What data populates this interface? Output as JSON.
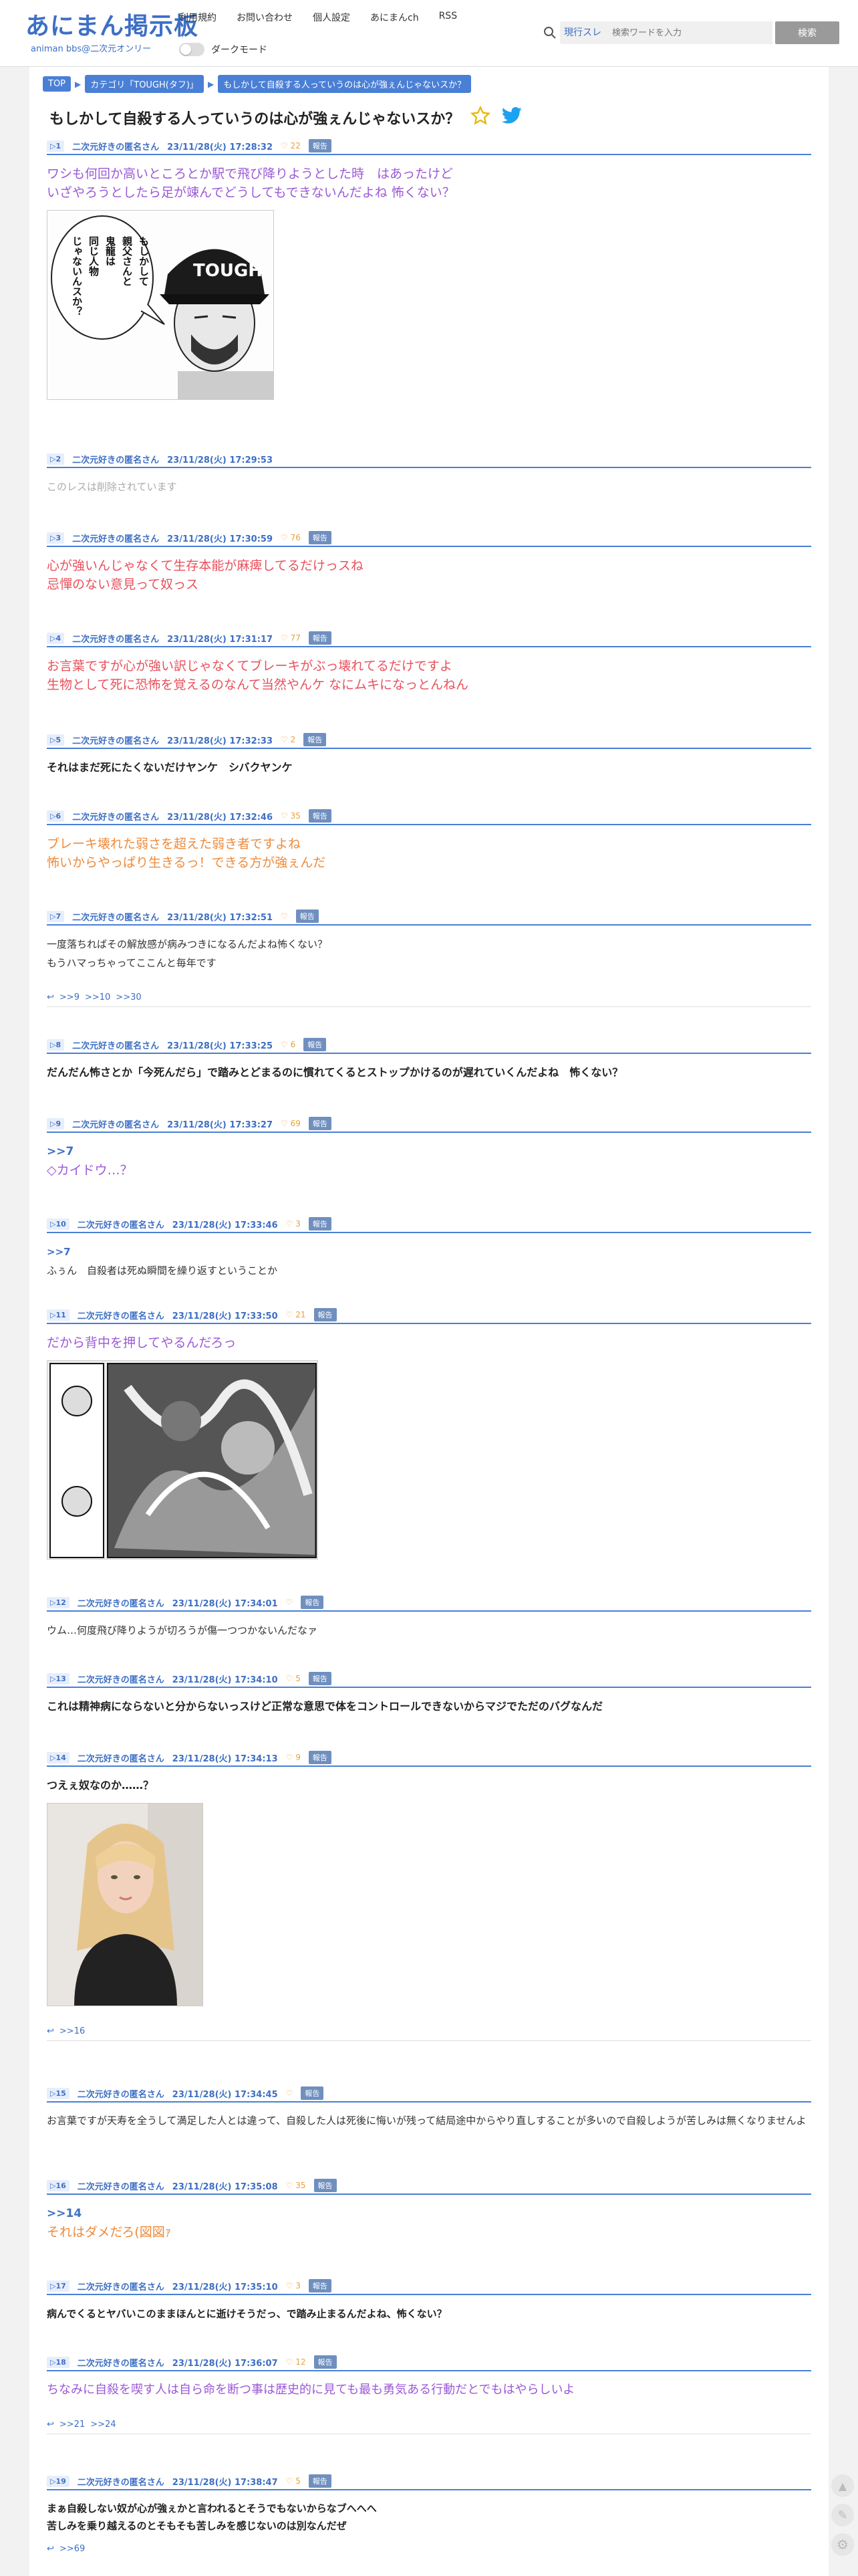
{
  "header": {
    "logo_main": "あにまん掲示板",
    "logo_sub": "animan bbs@二次元オンリー",
    "nav": [
      "利用規約",
      "お問い合わせ",
      "個人設定",
      "あにまんch",
      "RSS"
    ],
    "dark_mode_label": "ダークモード",
    "search_type": "現行スレ",
    "search_placeholder": "検索ワードを入力",
    "search_button": "検索"
  },
  "breadcrumb": [
    "TOP",
    "カテゴリ「TOUGH(タフ)」",
    "もしかして自殺する人っていうのは心が強ぇんじゃないスか？"
  ],
  "thread": {
    "title": "もしかして自殺する人っていうのは心が強ぇんじゃないスか？"
  },
  "common": {
    "name": "二次元好きの匿名さん",
    "report": "報告"
  },
  "posts": [
    {
      "num": "1",
      "date": "23/11/28(火) 17:28:32",
      "likes": "22",
      "lines": [
        "ワシも何回か高いところとか駅で飛び降りようとした時　はあったけど",
        "いざやろうとしたら足が竦んでどうしてもできないんだよね 怖くない？"
      ],
      "image_text": [
        "もしかして",
        "親父さんと",
        "鬼龍は",
        "同じ人物",
        "じゃないんスか？"
      ],
      "cap_text": "TOUGH"
    },
    {
      "num": "2",
      "date": "23/11/28(火) 17:29:53",
      "likes": "",
      "lines": [
        "このレスは削除されています"
      ]
    },
    {
      "num": "3",
      "date": "23/11/28(火) 17:30:59",
      "likes": "76",
      "lines": [
        "心が強いんじゃなくて生存本能が麻痺してるだけっスね",
        "忌憚のない意見って奴っス"
      ]
    },
    {
      "num": "4",
      "date": "23/11/28(火) 17:31:17",
      "likes": "77",
      "lines": [
        "お言葉ですが心が強い訳じゃなくてブレーキがぶっ壊れてるだけですよ",
        "生物として死に恐怖を覚えるのなんて当然やんケ なにムキになっとんねん"
      ]
    },
    {
      "num": "5",
      "date": "23/11/28(火) 17:32:33",
      "likes": "2",
      "lines": [
        "それはまだ死にたくないだけヤンケ　シバクヤンケ"
      ]
    },
    {
      "num": "6",
      "date": "23/11/28(火) 17:32:46",
      "likes": "35",
      "lines": [
        "ブレーキ壊れた弱さを超えた弱き者ですよね",
        "怖いからやっぱり生きるっ！できる方が強ぇんだ"
      ]
    },
    {
      "num": "7",
      "date": "23/11/28(火) 17:32:51",
      "likes": "",
      "lines": [
        "一度落ちればその解放感が病みつきになるんだよね怖くない？",
        "もうハマっちゃってここんと毎年です"
      ],
      "replies": [
        ">>9",
        ">>10",
        ">>30"
      ]
    },
    {
      "num": "8",
      "date": "23/11/28(火) 17:33:25",
      "likes": "6",
      "lines": [
        "だんだん怖さとか「今死んだら」で踏みとどまるのに慣れてくるとストップかけるのが遅れていくんだよね　怖くない？"
      ]
    },
    {
      "num": "9",
      "date": "23/11/28(火) 17:33:27",
      "likes": "69",
      "anchor": ">>7",
      "lines": [
        "◇カイドウ…？"
      ]
    },
    {
      "num": "10",
      "date": "23/11/28(火) 17:33:46",
      "likes": "3",
      "anchor": ">>7",
      "lines": [
        "ふぅん　自殺者は死ぬ瞬間を繰り返すということか"
      ]
    },
    {
      "num": "11",
      "date": "23/11/28(火) 17:33:50",
      "likes": "21",
      "lines": [
        "だから背中を押してやるんだろっ"
      ]
    },
    {
      "num": "12",
      "date": "23/11/28(火) 17:34:01",
      "likes": "",
      "lines": [
        "ウム…何度飛び降りようが切ろうが傷一つつかないんだなァ"
      ]
    },
    {
      "num": "13",
      "date": "23/11/28(火) 17:34:10",
      "likes": "5",
      "lines": [
        "これは精神病にならないと分からないっスけど正常な意思で体をコントロールできないからマジでただのバグなんだ"
      ]
    },
    {
      "num": "14",
      "date": "23/11/28(火) 17:34:13",
      "likes": "9",
      "lines": [
        "つえぇ奴なのか……？"
      ],
      "replies": [
        ">>16"
      ]
    },
    {
      "num": "15",
      "date": "23/11/28(火) 17:34:45",
      "likes": "",
      "lines": [
        "お言葉ですが天寿を全うして満足した人とは違って、自殺した人は死後に悔いが残って結局途中からやり直しすることが多いので自殺しようが苦しみは無くなりませんよ"
      ]
    },
    {
      "num": "16",
      "date": "23/11/28(火) 17:35:08",
      "likes": "35",
      "anchor": ">>14",
      "lines": [
        "それはダメだろ(図図ｧ"
      ]
    },
    {
      "num": "17",
      "date": "23/11/28(火) 17:35:10",
      "likes": "3",
      "lines": [
        "病んでくるとヤバいこのままほんとに逝けそうだっ、で踏み止まるんだよね、怖くない？"
      ]
    },
    {
      "num": "18",
      "date": "23/11/28(火) 17:36:07",
      "likes": "12",
      "lines": [
        "ちなみに自殺を喫す人は自ら命を断つ事は歴史的に見ても最も勇気ある行動だとでもはやらしいよ"
      ],
      "replies": [
        ">>21",
        ">>24"
      ]
    },
    {
      "num": "19",
      "date": "23/11/28(火) 17:38:47",
      "likes": "5",
      "lines": [
        "まぁ自殺しない奴が心が強ぇかと言われるとそうでもないからなブへへへ",
        "苦しみを乗り越えるのとそもそも苦しみを感じないのは別なんだぜ"
      ],
      "replies": [
        ">>69"
      ]
    }
  ]
}
